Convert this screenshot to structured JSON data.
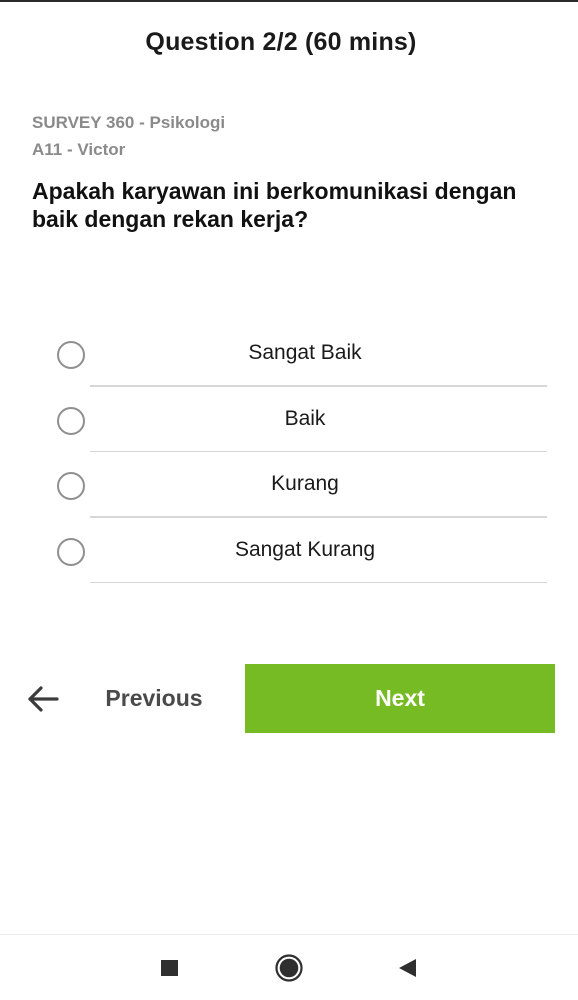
{
  "header": {
    "title": "Question 2/2 (60 mins)"
  },
  "survey": {
    "name": "SURVEY 360 - Psikologi",
    "subject": "A11 - Victor"
  },
  "question": {
    "text": "Apakah karyawan ini berkomunikasi dengan baik dengan rekan kerja?",
    "options": [
      {
        "label": "Sangat Baik",
        "selected": false
      },
      {
        "label": "Baik",
        "selected": false
      },
      {
        "label": "Kurang",
        "selected": false
      },
      {
        "label": "Sangat Kurang",
        "selected": false
      }
    ]
  },
  "navigation": {
    "back_icon": "arrow-left-icon",
    "previous_label": "Previous",
    "next_label": "Next",
    "next_color": "#76bb23"
  },
  "system_nav": {
    "recents_icon": "square-icon",
    "home_icon": "circle-icon",
    "back_icon": "triangle-back-icon"
  }
}
